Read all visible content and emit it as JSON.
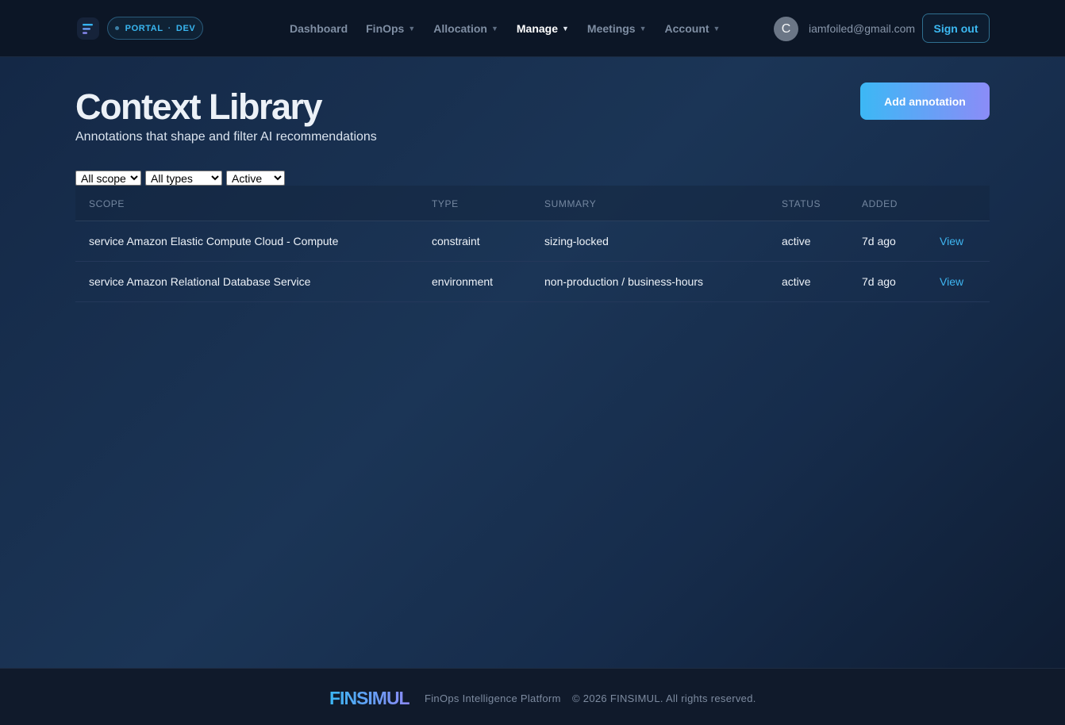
{
  "header": {
    "environment": {
      "label": "PORTAL",
      "separator": "·",
      "value": "DEV"
    },
    "nav": [
      {
        "label": "Dashboard",
        "has_caret": false
      },
      {
        "label": "FinOps",
        "has_caret": true
      },
      {
        "label": "Allocation",
        "has_caret": true
      },
      {
        "label": "Manage",
        "has_caret": true,
        "active": true
      },
      {
        "label": "Meetings",
        "has_caret": true
      },
      {
        "label": "Account",
        "has_caret": true
      }
    ],
    "caret_glyph": "▼",
    "user": {
      "avatar_initial": "C",
      "email": "iamfoiled@gmail.com"
    },
    "sign_out_label": "Sign out"
  },
  "page": {
    "title": "Context Library",
    "subtitle": "Annotations that shape and filter AI recommendations",
    "add_button_label": "Add annotation"
  },
  "filters": {
    "scope": {
      "selected": "All scopes"
    },
    "type": {
      "selected": "All types"
    },
    "status": {
      "selected": "Active"
    }
  },
  "table": {
    "columns": [
      "SCOPE",
      "TYPE",
      "SUMMARY",
      "STATUS",
      "ADDED",
      ""
    ],
    "rows": [
      {
        "scope": "service Amazon Elastic Compute Cloud - Compute",
        "type": "constraint",
        "summary": "sizing-locked",
        "status": "active",
        "added": "7d ago",
        "action": "View"
      },
      {
        "scope": "service Amazon Relational Database Service",
        "type": "environment",
        "summary": "non-production / business-hours",
        "status": "active",
        "added": "7d ago",
        "action": "View"
      }
    ]
  },
  "footer": {
    "brand": "FINSIMUL",
    "tagline": "FinOps Intelligence Platform",
    "copyright": "© 2026 FINSIMUL. All rights reserved."
  },
  "colors": {
    "accent": "#3cb9f2",
    "accent_gradient_end": "#8b8cf7",
    "background": "#142846"
  },
  "icons": [
    "app-logo-icon",
    "chevron-down-icon"
  ]
}
